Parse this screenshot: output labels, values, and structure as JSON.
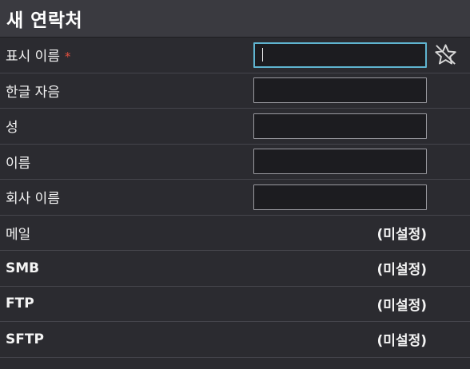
{
  "header": {
    "title": "새 연락처"
  },
  "fields": [
    {
      "label": "표시 이름",
      "required_mark": "*",
      "value": ""
    },
    {
      "label": "한글 자음",
      "value": ""
    },
    {
      "label": "성",
      "value": ""
    },
    {
      "label": "이름",
      "value": ""
    },
    {
      "label": "회사 이름",
      "value": ""
    }
  ],
  "links": [
    {
      "label": "메일",
      "value": "(미설정)"
    },
    {
      "label": "SMB",
      "value": "(미설정)"
    },
    {
      "label": "FTP",
      "value": "(미설정)"
    },
    {
      "label": "SFTP",
      "value": "(미설정)"
    }
  ],
  "icons": {
    "favorite": "star-off-icon"
  },
  "colors": {
    "background": "#2b2b30",
    "header": "#3a3a40",
    "focus": "#5fb4d0",
    "required": "#e2503f"
  }
}
